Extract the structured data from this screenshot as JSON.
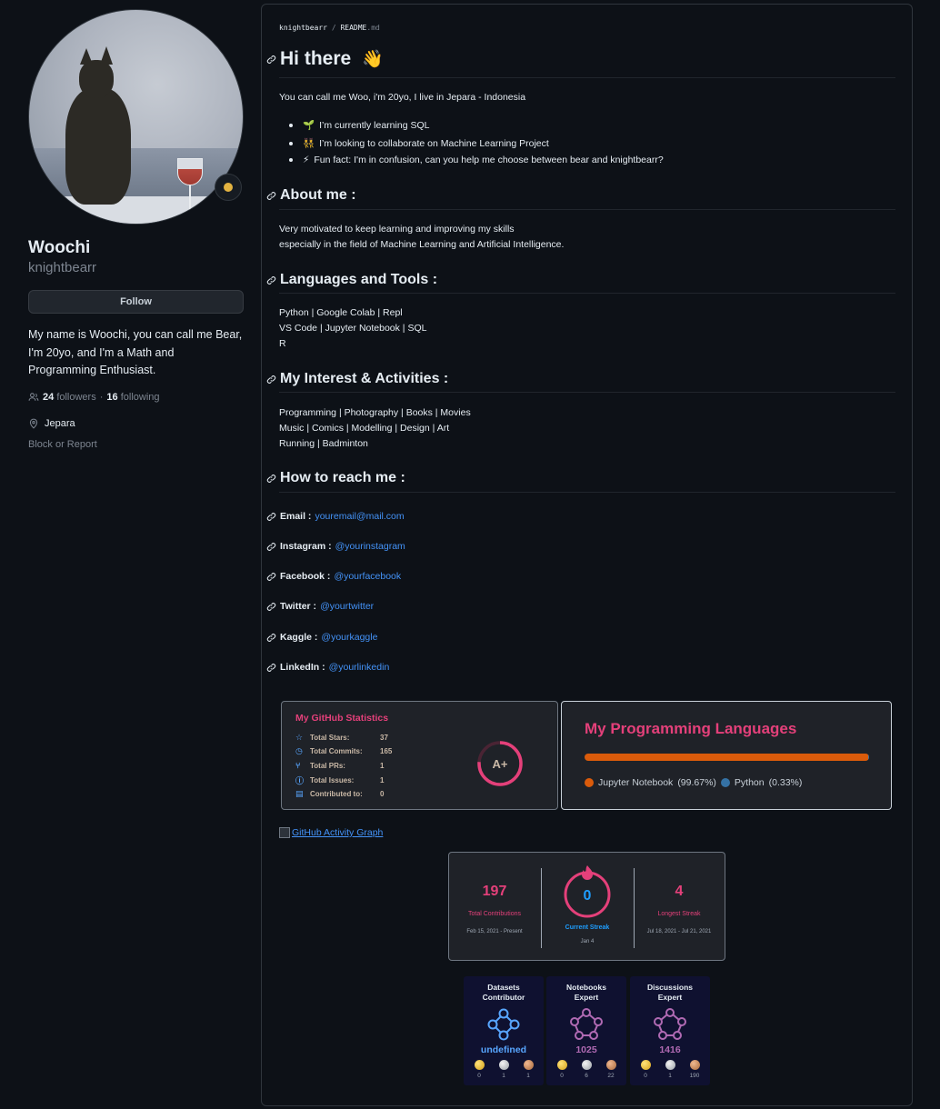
{
  "profile": {
    "fullname": "Woochi",
    "username": "knightbearr",
    "follow_label": "Follow",
    "bio": "My name is Woochi, you can call me Bear, I'm 20yo, and I'm a Math and Programming Enthusiast.",
    "followers_count": "24",
    "followers_label": "followers",
    "following_count": "16",
    "following_label": "following",
    "location": "Jepara",
    "block_label": "Block or Report",
    "status_color": "#e3b341"
  },
  "readme": {
    "crumb_user": "knightbearr",
    "crumb_sep": "/",
    "crumb_file": "README",
    "crumb_ext": ".md",
    "title": "Hi there",
    "title_emoji": "👋",
    "intro": "You can call me Woo, i'm 20yo, I live in Jepara - Indonesia",
    "bullets": [
      {
        "emoji": "🌱",
        "text": "I’m currently learning SQL"
      },
      {
        "emoji": "👯",
        "text": "I’m looking to collaborate on Machine Learning Project"
      },
      {
        "emoji": "⚡",
        "text": "Fun fact: I'm in confusion, can you help me choose between bear and knightbearr?"
      }
    ],
    "about_heading": "About me :",
    "about_line1": "Very motivated to keep learning and improving my skills",
    "about_line2": "especially in the field of Machine Learning and Artificial Intelligence.",
    "tools_heading": "Languages and Tools :",
    "tools_line1": "Python | Google Colab | Repl",
    "tools_line2": "VS Code | Jupyter Notebook | SQL",
    "tools_line3": "R",
    "interest_heading": "My Interest & Activities :",
    "interest_line1": "Programming | Photography | Books | Movies",
    "interest_line2": "Music | Comics | Modelling | Design | Art",
    "interest_line3": "Running | Badminton",
    "reach_heading": "How to reach me :",
    "contacts": [
      {
        "label": "Email :",
        "value": "youremail@mail.com"
      },
      {
        "label": "Instagram :",
        "value": "@yourinstagram"
      },
      {
        "label": "Facebook :",
        "value": "@yourfacebook"
      },
      {
        "label": "Twitter :",
        "value": "@yourtwitter"
      },
      {
        "label": "Kaggle :",
        "value": "@yourkaggle"
      },
      {
        "label": "LinkedIn :",
        "value": "@yourlinkedin"
      }
    ],
    "activity_graph_alt": "GitHub Activity Graph"
  },
  "stats_card": {
    "title": "My GitHub Statistics",
    "rows": [
      {
        "icon": "star-icon",
        "glyph": "☆",
        "label": "Total Stars:",
        "value": "37"
      },
      {
        "icon": "clock-icon",
        "glyph": "◷",
        "label": "Total Commits:",
        "value": "165"
      },
      {
        "icon": "pull-request-icon",
        "glyph": "⑂",
        "label": "Total PRs:",
        "value": "1"
      },
      {
        "icon": "issue-icon",
        "glyph": "ⓘ",
        "label": "Total Issues:",
        "value": "1"
      },
      {
        "icon": "repo-icon",
        "glyph": "▤",
        "label": "Contributed to:",
        "value": "0"
      }
    ],
    "grade": "A+",
    "accent": "#e4407a"
  },
  "lang_card": {
    "title": "My Programming Languages",
    "languages": [
      {
        "name": "Jupyter Notebook",
        "percent_label": "(99.67%)",
        "percent": 99.67,
        "color": "#da5b0b"
      },
      {
        "name": "Python",
        "percent_label": "(0.33%)",
        "percent": 0.33,
        "color": "#3572a5"
      }
    ]
  },
  "streak_card": {
    "total": "197",
    "total_label": "Total Contributions",
    "total_range": "Feb 15, 2021 - Present",
    "current": "0",
    "current_label": "Current Streak",
    "current_date": "Jan 4",
    "longest": "4",
    "longest_label": "Longest Streak",
    "longest_range": "Jul 18, 2021 - Jul 21, 2021"
  },
  "kaggle_badges": [
    {
      "title1": "Datasets",
      "title2": "Contributor",
      "value": "undefined",
      "value_color": "#58a6ff",
      "icon_color": "#58a6ff",
      "gold": "0",
      "silver": "1",
      "bronze": "1"
    },
    {
      "title1": "Notebooks",
      "title2": "Expert",
      "value": "1025",
      "value_color": "#b06ab3",
      "icon_color": "#b06ab3",
      "gold": "0",
      "silver": "6",
      "bronze": "22"
    },
    {
      "title1": "Discussions",
      "title2": "Expert",
      "value": "1416",
      "value_color": "#b06ab3",
      "icon_color": "#b06ab3",
      "gold": "0",
      "silver": "1",
      "bronze": "190"
    }
  ]
}
